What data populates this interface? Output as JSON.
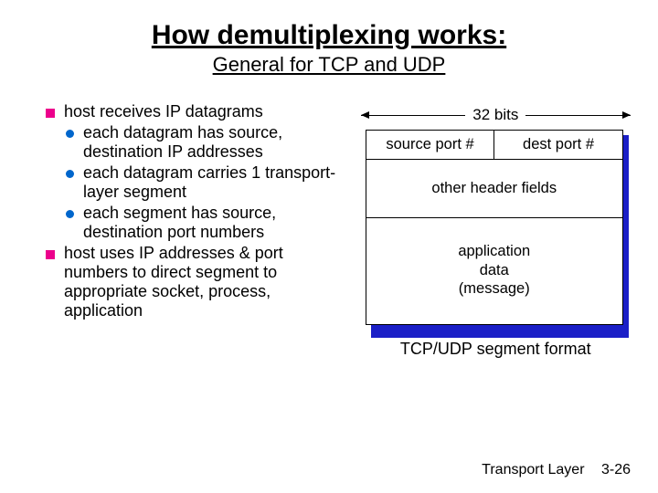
{
  "title": "How demultiplexing works:",
  "subtitle": "General for TCP and UDP",
  "bullets": {
    "b1": "host receives IP datagrams",
    "b1s1": "each datagram has source, destination IP addresses",
    "b1s2": "each datagram carries 1 transport-layer segment",
    "b1s3": "each segment has source, destination port numbers",
    "b2": "host uses IP addresses & port numbers to direct segment to appropriate socket, process, application"
  },
  "diagram": {
    "bits_label": "32 bits",
    "source_port": "source port #",
    "dest_port": "dest port #",
    "other_header": "other header fields",
    "app_data_l1": "application",
    "app_data_l2": "data",
    "app_data_l3": "(message)",
    "caption": "TCP/UDP segment format"
  },
  "footer": {
    "layer": "Transport Layer",
    "page": "3-26"
  }
}
